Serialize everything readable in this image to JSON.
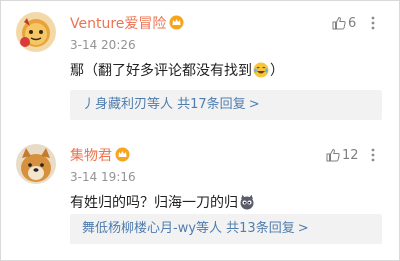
{
  "comments": [
    {
      "username": "Venture爱冒险",
      "time": "3-14 20:26",
      "like_count": "6",
      "text_before": "鄢（翻了好多评论都没有找到",
      "text_after": "）",
      "emoji_icon": "laughing-tears-emoji",
      "reply_summary": "丿身藏利刃等人  共17条回复",
      "avatar_icon": "cartoon-mascot-icon",
      "badge_icon": "vip-crown-badge-icon"
    },
    {
      "username": "集物君",
      "time": "3-14 19:16",
      "like_count": "12",
      "text_before": "有姓归的吗？归海一刀的归",
      "text_after": "",
      "emoji_icon": "cat-face-emoji",
      "reply_summary": "舞低杨柳楼心月-wy等人  共13条回复",
      "avatar_icon": "dog-avatar-icon",
      "badge_icon": "vip-crown-badge-icon"
    }
  ],
  "icons": {
    "like": "thumbs-up-icon",
    "more": "vertical-dots-icon",
    "chevron": "chevron-right-icon"
  },
  "colors": {
    "username": "#eb7350",
    "reply_link": "#507daf",
    "reply_bg": "#f2f2f2",
    "time": "#939393"
  },
  "chevron_text": ">"
}
